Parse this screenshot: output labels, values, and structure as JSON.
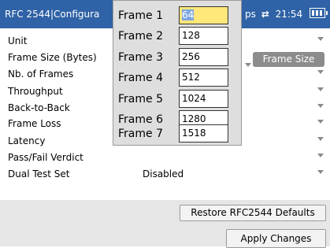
{
  "titlebar": {
    "title": "RFC 2544|Configura",
    "status_partial": "ps",
    "swap_icon": "swap-arrows-icon",
    "time": "21:54",
    "battery_icon": "battery-icon"
  },
  "form": {
    "rows": [
      {
        "label": "Unit",
        "value": ""
      },
      {
        "label": "Frame Size (Bytes)",
        "value": ""
      },
      {
        "label": "Nb. of Frames",
        "value": ""
      },
      {
        "label": "Throughput",
        "value": ""
      },
      {
        "label": "Back-to-Back",
        "value": ""
      },
      {
        "label": "Frame Loss",
        "value": ""
      },
      {
        "label": "Latency",
        "value": ""
      },
      {
        "label": "Pass/Fail Verdict",
        "value": ""
      },
      {
        "label": "Dual Test Set",
        "value": "Disabled"
      }
    ],
    "frame_size_button": "Frame Size"
  },
  "popup": {
    "frames": [
      {
        "label": "Frame 1",
        "value": "64"
      },
      {
        "label": "Frame 2",
        "value": "128"
      },
      {
        "label": "Frame 3",
        "value": "256"
      },
      {
        "label": "Frame 4",
        "value": "512"
      },
      {
        "label": "Frame 5",
        "value": "1024"
      },
      {
        "label": "Frame 6",
        "value": "1280"
      },
      {
        "label": "Frame 7",
        "value": "1518"
      }
    ]
  },
  "buttons": {
    "restore": "Restore RFC2544 Defaults",
    "apply": "Apply Changes"
  },
  "colors": {
    "titlebar": "#2f62a6",
    "focused_input": "#ffe77a",
    "frame_size_button": "#8c8c8c"
  }
}
